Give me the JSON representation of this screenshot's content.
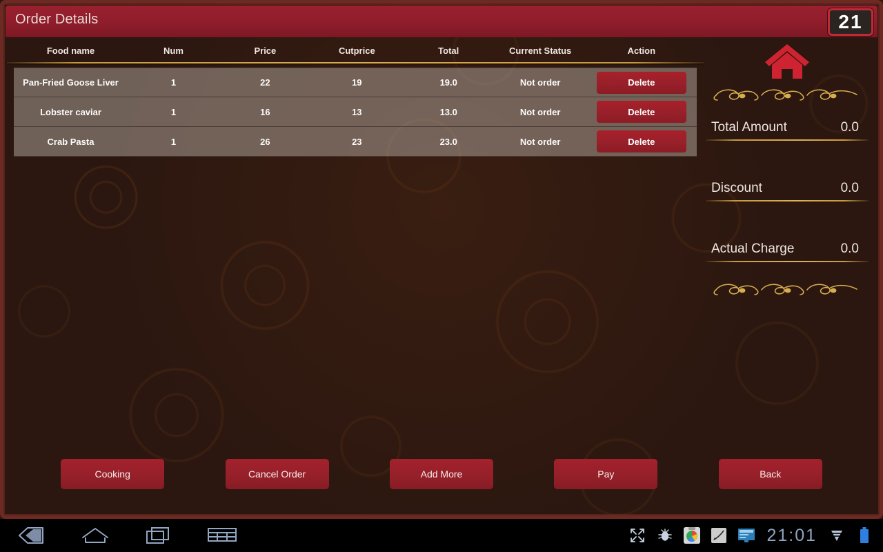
{
  "window": {
    "title": "Order Details",
    "badge": "21"
  },
  "table": {
    "columns": [
      {
        "key": "food",
        "label": "Food name"
      },
      {
        "key": "num",
        "label": "Num"
      },
      {
        "key": "price",
        "label": "Price"
      },
      {
        "key": "cut",
        "label": "Cutprice"
      },
      {
        "key": "total",
        "label": "Total"
      },
      {
        "key": "status",
        "label": "Current Status"
      },
      {
        "key": "action",
        "label": "Action"
      }
    ],
    "rows": [
      {
        "food": "Pan-Fried Goose Liver",
        "num": "1",
        "price": "22",
        "cut": "19",
        "total": "19.0",
        "status": "Not order",
        "action_label": "Delete"
      },
      {
        "food": "Lobster caviar",
        "num": "1",
        "price": "16",
        "cut": "13",
        "total": "13.0",
        "status": "Not order",
        "action_label": "Delete"
      },
      {
        "food": "Crab Pasta",
        "num": "1",
        "price": "26",
        "cut": "23",
        "total": "23.0",
        "status": "Not order",
        "action_label": "Delete"
      }
    ]
  },
  "summary": {
    "home_icon": "home-icon",
    "total_amount": {
      "label": "Total Amount",
      "value": "0.0"
    },
    "discount": {
      "label": "Discount",
      "value": "0.0"
    },
    "actual_charge": {
      "label": "Actual Charge",
      "value": "0.0"
    }
  },
  "actions": [
    {
      "name": "cooking",
      "label": "Cooking"
    },
    {
      "name": "cancel-order",
      "label": "Cancel Order"
    },
    {
      "name": "add-more",
      "label": "Add More"
    },
    {
      "name": "pay",
      "label": "Pay"
    },
    {
      "name": "back",
      "label": "Back"
    }
  ],
  "system_bar": {
    "nav": [
      {
        "name": "back-icon"
      },
      {
        "name": "home-icon"
      },
      {
        "name": "recent-apps-icon"
      },
      {
        "name": "keyboard-icon"
      }
    ],
    "tray": [
      {
        "name": "fullscreen-icon"
      },
      {
        "name": "bug-icon"
      },
      {
        "name": "app-icon"
      },
      {
        "name": "mouse-icon"
      },
      {
        "name": "display-icon"
      }
    ],
    "clock": "21:01",
    "signal_icon": "signal-icon",
    "battery_icon": "battery-icon"
  },
  "colors": {
    "titlebar": "#8f1d2b",
    "button_red": "#99202a",
    "gold_rule": "#c79b3d",
    "background": "#2b1710",
    "row_bg": "#6b625d",
    "badge_border": "#c02a34",
    "clock_text": "#8fa4c0"
  }
}
